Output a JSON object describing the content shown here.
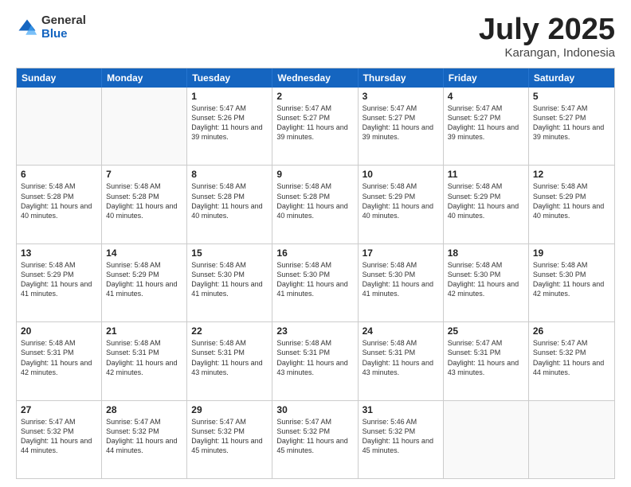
{
  "header": {
    "logo": {
      "general": "General",
      "blue": "Blue"
    },
    "title": "July 2025",
    "location": "Karangan, Indonesia"
  },
  "weekdays": [
    "Sunday",
    "Monday",
    "Tuesday",
    "Wednesday",
    "Thursday",
    "Friday",
    "Saturday"
  ],
  "rows": [
    [
      {
        "day": "",
        "empty": true
      },
      {
        "day": "",
        "empty": true
      },
      {
        "day": "1",
        "sunrise": "5:47 AM",
        "sunset": "5:26 PM",
        "daylight": "11 hours and 39 minutes."
      },
      {
        "day": "2",
        "sunrise": "5:47 AM",
        "sunset": "5:27 PM",
        "daylight": "11 hours and 39 minutes."
      },
      {
        "day": "3",
        "sunrise": "5:47 AM",
        "sunset": "5:27 PM",
        "daylight": "11 hours and 39 minutes."
      },
      {
        "day": "4",
        "sunrise": "5:47 AM",
        "sunset": "5:27 PM",
        "daylight": "11 hours and 39 minutes."
      },
      {
        "day": "5",
        "sunrise": "5:47 AM",
        "sunset": "5:27 PM",
        "daylight": "11 hours and 39 minutes."
      }
    ],
    [
      {
        "day": "6",
        "sunrise": "5:48 AM",
        "sunset": "5:28 PM",
        "daylight": "11 hours and 40 minutes."
      },
      {
        "day": "7",
        "sunrise": "5:48 AM",
        "sunset": "5:28 PM",
        "daylight": "11 hours and 40 minutes."
      },
      {
        "day": "8",
        "sunrise": "5:48 AM",
        "sunset": "5:28 PM",
        "daylight": "11 hours and 40 minutes."
      },
      {
        "day": "9",
        "sunrise": "5:48 AM",
        "sunset": "5:28 PM",
        "daylight": "11 hours and 40 minutes."
      },
      {
        "day": "10",
        "sunrise": "5:48 AM",
        "sunset": "5:29 PM",
        "daylight": "11 hours and 40 minutes."
      },
      {
        "day": "11",
        "sunrise": "5:48 AM",
        "sunset": "5:29 PM",
        "daylight": "11 hours and 40 minutes."
      },
      {
        "day": "12",
        "sunrise": "5:48 AM",
        "sunset": "5:29 PM",
        "daylight": "11 hours and 40 minutes."
      }
    ],
    [
      {
        "day": "13",
        "sunrise": "5:48 AM",
        "sunset": "5:29 PM",
        "daylight": "11 hours and 41 minutes."
      },
      {
        "day": "14",
        "sunrise": "5:48 AM",
        "sunset": "5:29 PM",
        "daylight": "11 hours and 41 minutes."
      },
      {
        "day": "15",
        "sunrise": "5:48 AM",
        "sunset": "5:30 PM",
        "daylight": "11 hours and 41 minutes."
      },
      {
        "day": "16",
        "sunrise": "5:48 AM",
        "sunset": "5:30 PM",
        "daylight": "11 hours and 41 minutes."
      },
      {
        "day": "17",
        "sunrise": "5:48 AM",
        "sunset": "5:30 PM",
        "daylight": "11 hours and 41 minutes."
      },
      {
        "day": "18",
        "sunrise": "5:48 AM",
        "sunset": "5:30 PM",
        "daylight": "11 hours and 42 minutes."
      },
      {
        "day": "19",
        "sunrise": "5:48 AM",
        "sunset": "5:30 PM",
        "daylight": "11 hours and 42 minutes."
      }
    ],
    [
      {
        "day": "20",
        "sunrise": "5:48 AM",
        "sunset": "5:31 PM",
        "daylight": "11 hours and 42 minutes."
      },
      {
        "day": "21",
        "sunrise": "5:48 AM",
        "sunset": "5:31 PM",
        "daylight": "11 hours and 42 minutes."
      },
      {
        "day": "22",
        "sunrise": "5:48 AM",
        "sunset": "5:31 PM",
        "daylight": "11 hours and 43 minutes."
      },
      {
        "day": "23",
        "sunrise": "5:48 AM",
        "sunset": "5:31 PM",
        "daylight": "11 hours and 43 minutes."
      },
      {
        "day": "24",
        "sunrise": "5:48 AM",
        "sunset": "5:31 PM",
        "daylight": "11 hours and 43 minutes."
      },
      {
        "day": "25",
        "sunrise": "5:47 AM",
        "sunset": "5:31 PM",
        "daylight": "11 hours and 43 minutes."
      },
      {
        "day": "26",
        "sunrise": "5:47 AM",
        "sunset": "5:32 PM",
        "daylight": "11 hours and 44 minutes."
      }
    ],
    [
      {
        "day": "27",
        "sunrise": "5:47 AM",
        "sunset": "5:32 PM",
        "daylight": "11 hours and 44 minutes."
      },
      {
        "day": "28",
        "sunrise": "5:47 AM",
        "sunset": "5:32 PM",
        "daylight": "11 hours and 44 minutes."
      },
      {
        "day": "29",
        "sunrise": "5:47 AM",
        "sunset": "5:32 PM",
        "daylight": "11 hours and 45 minutes."
      },
      {
        "day": "30",
        "sunrise": "5:47 AM",
        "sunset": "5:32 PM",
        "daylight": "11 hours and 45 minutes."
      },
      {
        "day": "31",
        "sunrise": "5:46 AM",
        "sunset": "5:32 PM",
        "daylight": "11 hours and 45 minutes."
      },
      {
        "day": "",
        "empty": true
      },
      {
        "day": "",
        "empty": true
      }
    ]
  ]
}
